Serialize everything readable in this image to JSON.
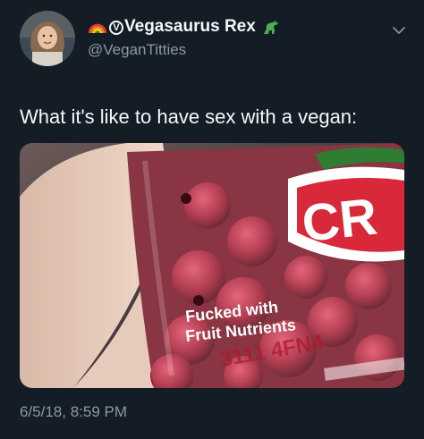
{
  "tweet": {
    "display_name": "Vegasaurus Rex",
    "display_name_prefix_glyph": "V",
    "handle": "@VeganTitties",
    "text": "What it's like to have sex with a vegan:",
    "timestamp": "6/5/18, 8:59 PM"
  },
  "media": {
    "label_line1": "Fucked with",
    "label_line2": "Fruit Nutrients",
    "brand_partial": "CR",
    "code_text": "3111 4FN4"
  },
  "icons": {
    "prefix_emoji": "rainbow-icon",
    "suffix_emoji": "dinosaur-icon",
    "menu": "chevron-down-icon"
  },
  "colors": {
    "background": "#141d26",
    "primary_text": "#f5f8fa",
    "secondary_text": "#8899a6"
  }
}
